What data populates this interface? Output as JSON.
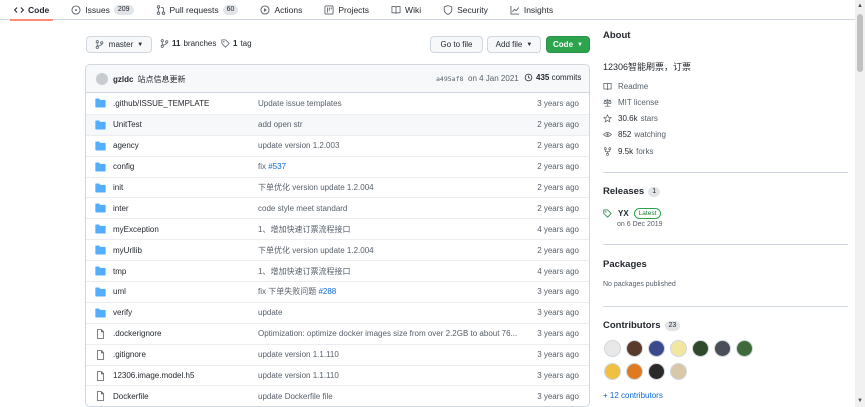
{
  "tabs": [
    {
      "label": "Code",
      "icon": "code-icon",
      "selected": true
    },
    {
      "label": "Issues",
      "icon": "issue-icon",
      "count": "209"
    },
    {
      "label": "Pull requests",
      "icon": "pull-request-icon",
      "count": "60"
    },
    {
      "label": "Actions",
      "icon": "play-icon"
    },
    {
      "label": "Projects",
      "icon": "project-icon"
    },
    {
      "label": "Wiki",
      "icon": "book-icon"
    },
    {
      "label": "Security",
      "icon": "shield-icon"
    },
    {
      "label": "Insights",
      "icon": "graph-icon"
    }
  ],
  "toolbar": {
    "branch": "master",
    "branches_count": "11",
    "branches_label": "branches",
    "tags_count": "1",
    "tags_label": "tag",
    "go_to_file": "Go to file",
    "add_file": "Add file",
    "code": "Code"
  },
  "commit": {
    "user": "gzldc",
    "message": "站点信息更新",
    "sha": "a495af8",
    "date": "on 4 Jan 2021",
    "count": "435",
    "count_label": "commits"
  },
  "files": [
    {
      "type": "dir",
      "name": ".github/ISSUE_TEMPLATE",
      "msg": "Update issue templates",
      "issue": "",
      "age": "3 years ago"
    },
    {
      "type": "dir",
      "name": "UnitTest",
      "msg": "add open str",
      "issue": "",
      "age": "2 years ago"
    },
    {
      "type": "dir",
      "name": "agency",
      "msg": "update version 1.2.003",
      "issue": "",
      "age": "2 years ago"
    },
    {
      "type": "dir",
      "name": "config",
      "msg": "fix ",
      "issue": "#537",
      "age": "2 years ago"
    },
    {
      "type": "dir",
      "name": "init",
      "msg": "下单优化 version update 1.2.004",
      "issue": "",
      "age": "2 years ago"
    },
    {
      "type": "dir",
      "name": "inter",
      "msg": "code style meet standard",
      "issue": "",
      "age": "2 years ago"
    },
    {
      "type": "dir",
      "name": "myException",
      "msg": "1、增加快速订票流程接口",
      "issue": "",
      "age": "4 years ago"
    },
    {
      "type": "dir",
      "name": "myUrllib",
      "msg": "下单优化 version update 1.2.004",
      "issue": "",
      "age": "2 years ago"
    },
    {
      "type": "dir",
      "name": "tmp",
      "msg": "1、增加快速订票流程接口",
      "issue": "",
      "age": "4 years ago"
    },
    {
      "type": "dir",
      "name": "uml",
      "msg": "fix 下单失败问题 ",
      "issue": "#288",
      "age": "3 years ago"
    },
    {
      "type": "dir",
      "name": "verify",
      "msg": "update",
      "issue": "",
      "age": "3 years ago"
    },
    {
      "type": "file",
      "name": ".dockerignore",
      "msg": "Optimization: optimize docker images size from over 2.2GB to about 76...",
      "issue": "",
      "age": "3 years ago"
    },
    {
      "type": "file",
      "name": ".gitignore",
      "msg": "update version 1.1.110",
      "issue": "",
      "age": "3 years ago"
    },
    {
      "type": "file",
      "name": "12306.image.model.h5",
      "msg": "update version 1.1.110",
      "issue": "",
      "age": "3 years ago"
    },
    {
      "type": "file",
      "name": "Dockerfile",
      "msg": "update Dockerfile file",
      "issue": "",
      "age": "3 years ago"
    }
  ],
  "about": {
    "title": "About",
    "description": "12306智能刷票，订票",
    "readme": "Readme",
    "license": "MIT license",
    "stars_count": "30.6k",
    "stars_label": "stars",
    "watching_count": "852",
    "watching_label": "watching",
    "forks_count": "9.5k",
    "forks_label": "forks"
  },
  "releases": {
    "title": "Releases",
    "count": "1",
    "name": "YX",
    "badge": "Latest",
    "date": "on 6 Dec 2019"
  },
  "packages": {
    "title": "Packages",
    "empty": "No packages published"
  },
  "contributors": {
    "title": "Contributors",
    "count": "23",
    "more": "+ 12 contributors",
    "avatar_colors": [
      "#e8e8e8",
      "#5a3a28",
      "#3b4a8c",
      "#f3e6a0",
      "#2e4a2a",
      "#4a4f57",
      "#3f6a3a",
      "#f0c040",
      "#e07a20",
      "#2a2a2a",
      "#d8c8a8"
    ]
  },
  "colors": {
    "accent_green": "#2da44e",
    "link_blue": "#0969da",
    "folder_blue": "#54aeff",
    "tab_underline": "#fd8c73"
  }
}
